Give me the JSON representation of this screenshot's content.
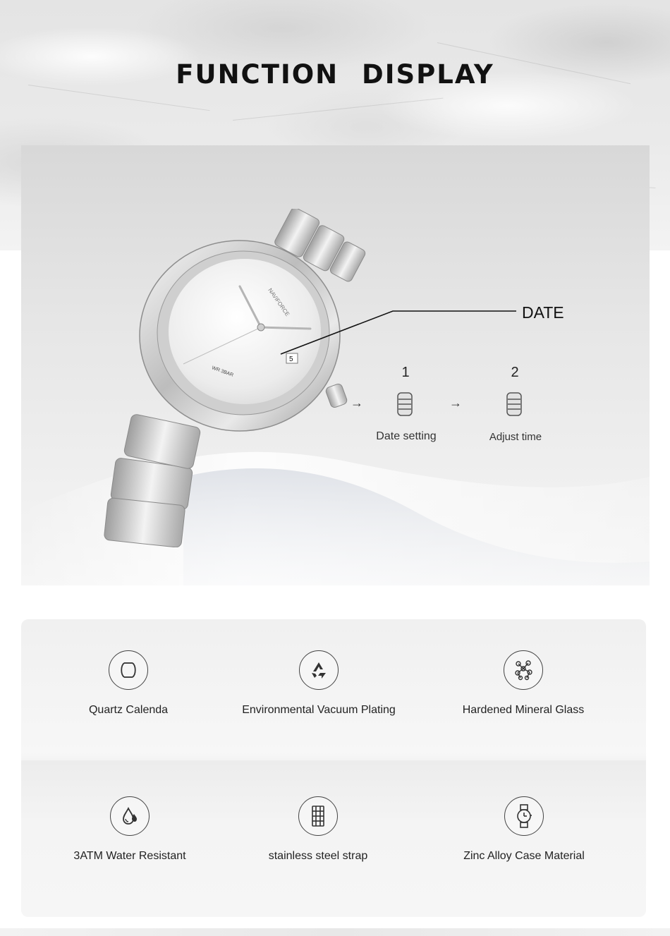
{
  "headline": "FUNCTION DISPLAY",
  "watch": {
    "brand": "NAVIFORCE",
    "dial_text": "WR 3BAR",
    "date_window": "5"
  },
  "callout": {
    "label": "DATE",
    "steps": [
      {
        "number": "1",
        "caption": "Date setting"
      },
      {
        "number": "2",
        "caption": "Adjust time"
      }
    ]
  },
  "features": [
    {
      "label": "Quartz Calenda",
      "icon": "quartz-movement-icon"
    },
    {
      "label": "Environmental Vacuum Plating",
      "icon": "recycle-icon"
    },
    {
      "label": "Hardened Mineral Glass",
      "icon": "molecule-icon"
    },
    {
      "label": "3ATM Water Resistant",
      "icon": "water-drop-icon"
    },
    {
      "label": "stainless steel strap",
      "icon": "strap-icon"
    },
    {
      "label": "Zinc Alloy Case Material",
      "icon": "watch-icon"
    }
  ],
  "colors": {
    "text": "#111111",
    "icon_stroke": "#444444",
    "panel": "#e6e6e6"
  }
}
